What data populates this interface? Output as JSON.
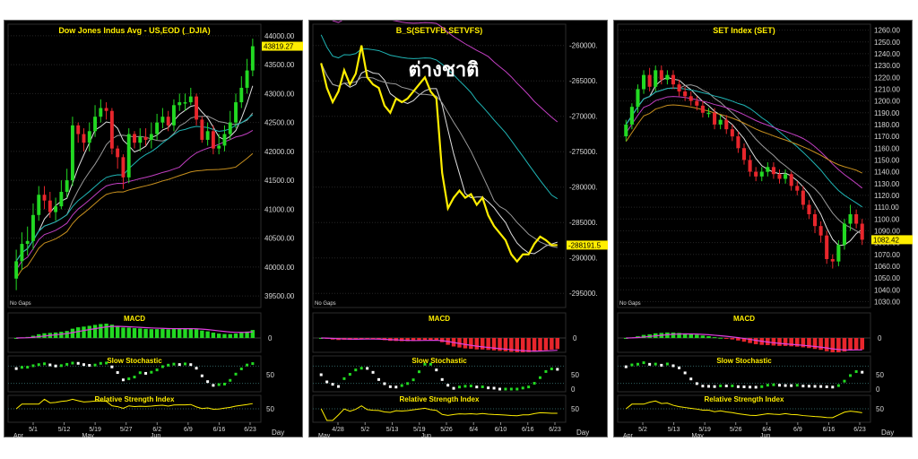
{
  "panels": [
    {
      "title": "Dow Jones Indus Avg - US,EOD (_DJIA)",
      "watermark": "",
      "axis_labels": [
        "44000.00",
        "43500.00",
        "43000.00",
        "42500.00",
        "42000.00",
        "41500.00",
        "41000.00",
        "40500.00",
        "40000.00",
        "39500.00"
      ],
      "last_price": "43819.27",
      "no_gaps": "No Gaps",
      "macd_label": "MACD",
      "macd_zero": "0",
      "stoch_label": "Slow Stochastic",
      "stoch_ticks": [
        "50"
      ],
      "rsi_label": "Relative Strength Index",
      "rsi_ticks": [
        "50"
      ],
      "dates": [
        "5/1",
        "5/12",
        "5/19",
        "5/27",
        "6/2",
        "6/9",
        "6/16",
        "6/23"
      ],
      "months": [
        "Apr",
        "May",
        "Jun"
      ],
      "day_label": "Day"
    },
    {
      "title": "B_S(SETVFB,SETVFS)",
      "watermark": "ต่างชาติ",
      "axis_labels": [
        "-260000.",
        "-265000.",
        "-270000.",
        "-275000.",
        "-280000.",
        "-285000.",
        "-290000.",
        "-295000."
      ],
      "last_price": "-288191.5",
      "no_gaps": "No Gaps",
      "macd_label": "MACD",
      "macd_zero": "0",
      "stoch_label": "Slow Stochastic",
      "stoch_ticks": [
        "50",
        "0"
      ],
      "rsi_label": "Relative Strength Index",
      "rsi_ticks": [
        "50"
      ],
      "dates": [
        "4/28",
        "5/2",
        "5/13",
        "5/19",
        "5/26",
        "6/4",
        "6/10",
        "6/16",
        "6/23"
      ],
      "months": [
        "May",
        "Jun"
      ],
      "day_label": "Day"
    },
    {
      "title": "SET Index (SET)",
      "watermark": "",
      "axis_labels": [
        "1260.00",
        "1250.00",
        "1240.00",
        "1230.00",
        "1220.00",
        "1210.00",
        "1200.00",
        "1190.00",
        "1180.00",
        "1170.00",
        "1160.00",
        "1150.00",
        "1140.00",
        "1130.00",
        "1120.00",
        "1110.00",
        "1100.00",
        "1090.00",
        "1080.00",
        "1070.00",
        "1060.00",
        "1050.00",
        "1040.00",
        "1030.00"
      ],
      "last_price": "1082.42",
      "no_gaps": "No Gaps",
      "macd_label": "MACD",
      "macd_zero": "0",
      "stoch_label": "Slow Stochastic",
      "stoch_ticks": [
        "50",
        "0"
      ],
      "rsi_label": "Relative Strength Index",
      "rsi_ticks": [
        "50"
      ],
      "dates": [
        "5/2",
        "5/13",
        "5/19",
        "5/26",
        "6/4",
        "6/9",
        "6/16",
        "6/23"
      ],
      "months": [
        "Apr",
        "May",
        "Jun"
      ],
      "day_label": "Day"
    }
  ],
  "colors": {
    "background": "#000000",
    "up_candle": "#22d922",
    "down_candle": "#e8262c",
    "price_line": "#ffee00",
    "title_text": "#ffee00",
    "ma_white": "#e0e0e0",
    "ma_grey": "#9a9a9a",
    "ma_cyan": "#1fb5b5",
    "ma_magenta": "#c23fc2",
    "ma_orange": "#c8901e",
    "macd_line": "#e040e0",
    "macd_pos": "#22d922",
    "macd_neg": "#e8262c",
    "stoch_dots": "#ffffff",
    "stoch_up": "#22d922",
    "rsi_line": "#ffee00",
    "last_price_bg": "#ffee00"
  },
  "chart_data": [
    {
      "type": "candlestick",
      "title": "Dow Jones Indus Avg - US,EOD (_DJIA)",
      "ylim": [
        39300,
        44200
      ],
      "x": [
        "4/28",
        "4/29",
        "4/30",
        "5/1",
        "5/2",
        "5/5",
        "5/6",
        "5/7",
        "5/8",
        "5/9",
        "5/12",
        "5/13",
        "5/14",
        "5/15",
        "5/16",
        "5/19",
        "5/20",
        "5/21",
        "5/22",
        "5/23",
        "5/27",
        "5/28",
        "5/29",
        "5/30",
        "6/2",
        "6/3",
        "6/4",
        "6/5",
        "6/6",
        "6/9",
        "6/10",
        "6/11",
        "6/12",
        "6/13",
        "6/16",
        "6/17",
        "6/18",
        "6/20",
        "6/23",
        "6/24",
        "6/25",
        "6/26",
        "6/27"
      ],
      "open": [
        39800,
        40100,
        40400,
        40450,
        40900,
        41250,
        41150,
        40950,
        41050,
        41300,
        41500,
        42450,
        42300,
        42150,
        42350,
        42600,
        42750,
        42700,
        42050,
        41900,
        41550,
        42300,
        42150,
        42250,
        42200,
        42300,
        42500,
        42600,
        42450,
        42800,
        42850,
        42850,
        42950,
        42550,
        42200,
        42350,
        42050,
        42100,
        42300,
        42500,
        42850,
        43100,
        43400
      ],
      "close": [
        40100,
        40400,
        40450,
        40900,
        41250,
        41150,
        40950,
        41050,
        41300,
        41500,
        42450,
        42300,
        42150,
        42350,
        42600,
        42750,
        42700,
        42050,
        41900,
        41550,
        42300,
        42150,
        42250,
        42200,
        42300,
        42500,
        42600,
        42450,
        42800,
        42850,
        42850,
        42950,
        42550,
        42200,
        42350,
        42050,
        42100,
        42300,
        42500,
        42850,
        43100,
        43400,
        43819.27
      ],
      "high": [
        40300,
        40600,
        40700,
        41100,
        41400,
        41400,
        41300,
        41200,
        41500,
        41700,
        42600,
        42500,
        42400,
        42500,
        42800,
        42900,
        42850,
        42750,
        42100,
        41950,
        42400,
        42350,
        42400,
        42400,
        42500,
        42650,
        42750,
        42700,
        42900,
        43000,
        43000,
        43100,
        43000,
        42600,
        42500,
        42450,
        42300,
        42450,
        42700,
        43000,
        43300,
        43600,
        43950
      ],
      "low": [
        39600,
        39950,
        40200,
        40300,
        40800,
        41000,
        40850,
        40800,
        41000,
        41200,
        41400,
        42150,
        42000,
        42000,
        42250,
        42500,
        42550,
        41950,
        41700,
        41350,
        41450,
        42050,
        42000,
        42100,
        42050,
        42200,
        42400,
        42350,
        42350,
        42700,
        42700,
        42800,
        42450,
        42150,
        42100,
        41950,
        41950,
        42000,
        42200,
        42400,
        42750,
        43000,
        43300
      ],
      "last": 43819.27
    },
    {
      "type": "line",
      "title": "B_S(SETVFB,SETVFS)",
      "ylim": [
        -297000,
        -257000
      ],
      "x": [
        "4/24",
        "4/25",
        "4/28",
        "4/29",
        "4/30",
        "5/2",
        "5/6",
        "5/7",
        "5/8",
        "5/9",
        "5/13",
        "5/14",
        "5/15",
        "5/16",
        "5/19",
        "5/20",
        "5/21",
        "5/22",
        "5/23",
        "5/26",
        "5/27",
        "5/28",
        "5/29",
        "5/30",
        "6/3",
        "6/4",
        "6/5",
        "6/6",
        "6/10",
        "6/11",
        "6/12",
        "6/13",
        "6/16",
        "6/17",
        "6/18",
        "6/19",
        "6/20",
        "6/23",
        "6/24",
        "6/25",
        "6/26",
        "6/27"
      ],
      "series": [
        {
          "values": [
            -262500,
            -266000,
            -268000,
            -266500,
            -263500,
            -265500,
            -264000,
            -260000,
            -264500,
            -265500,
            -266000,
            -268500,
            -269500,
            -267500,
            -268000,
            -267500,
            -266500,
            -265500,
            -264500,
            -266500,
            -267500,
            -278000,
            -283000,
            -281500,
            -280500,
            -281500,
            -281000,
            -282500,
            -281500,
            -284000,
            -285500,
            -286500,
            -287500,
            -289500,
            -290500,
            -289500,
            -289500,
            -288000,
            -287000,
            -287500,
            -288191.5,
            -288191.5
          ]
        }
      ],
      "last": -288191.5
    },
    {
      "type": "candlestick",
      "title": "SET Index (SET)",
      "ylim": [
        1025,
        1265
      ],
      "x": [
        "4/25",
        "4/28",
        "4/29",
        "4/30",
        "5/2",
        "5/6",
        "5/7",
        "5/8",
        "5/9",
        "5/13",
        "5/14",
        "5/15",
        "5/16",
        "5/19",
        "5/20",
        "5/21",
        "5/22",
        "5/23",
        "5/26",
        "5/27",
        "5/28",
        "5/29",
        "5/30",
        "6/2",
        "6/4",
        "6/5",
        "6/6",
        "6/9",
        "6/10",
        "6/11",
        "6/12",
        "6/13",
        "6/16",
        "6/17",
        "6/18",
        "6/19",
        "6/20",
        "6/23",
        "6/24",
        "6/25",
        "6/26"
      ],
      "open": [
        1170,
        1180,
        1195,
        1210,
        1222,
        1212,
        1226,
        1218,
        1222,
        1214,
        1208,
        1204,
        1200,
        1196,
        1190,
        1190,
        1180,
        1184,
        1176,
        1170,
        1160,
        1150,
        1140,
        1136,
        1140,
        1144,
        1138,
        1134,
        1138,
        1128,
        1124,
        1112,
        1104,
        1094,
        1086,
        1066,
        1064,
        1078,
        1096,
        1104,
        1096
      ],
      "close": [
        1180,
        1195,
        1210,
        1222,
        1212,
        1226,
        1218,
        1222,
        1214,
        1208,
        1204,
        1200,
        1196,
        1190,
        1190,
        1180,
        1184,
        1176,
        1170,
        1160,
        1150,
        1140,
        1136,
        1140,
        1144,
        1138,
        1134,
        1138,
        1128,
        1124,
        1112,
        1104,
        1094,
        1086,
        1066,
        1064,
        1078,
        1096,
        1104,
        1096,
        1082.42
      ],
      "high": [
        1184,
        1198,
        1214,
        1226,
        1228,
        1230,
        1230,
        1226,
        1226,
        1218,
        1212,
        1208,
        1204,
        1200,
        1194,
        1194,
        1188,
        1188,
        1180,
        1174,
        1164,
        1154,
        1144,
        1144,
        1148,
        1148,
        1142,
        1142,
        1140,
        1132,
        1128,
        1116,
        1108,
        1098,
        1090,
        1070,
        1082,
        1100,
        1112,
        1108,
        1100
      ],
      "low": [
        1166,
        1176,
        1190,
        1206,
        1208,
        1208,
        1214,
        1214,
        1210,
        1204,
        1200,
        1196,
        1192,
        1186,
        1186,
        1176,
        1176,
        1172,
        1166,
        1156,
        1146,
        1136,
        1132,
        1132,
        1136,
        1134,
        1130,
        1130,
        1124,
        1120,
        1108,
        1100,
        1088,
        1080,
        1062,
        1058,
        1060,
        1074,
        1090,
        1092,
        1078
      ],
      "last": 1082.42
    }
  ]
}
